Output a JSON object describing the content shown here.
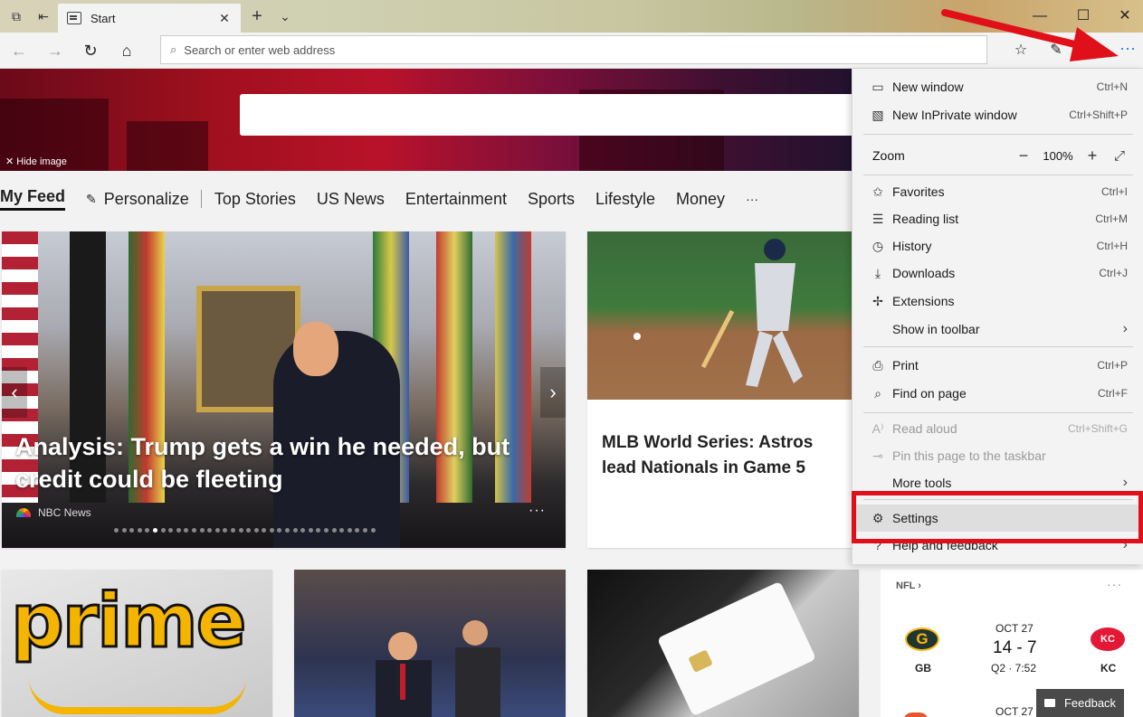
{
  "browser": {
    "tab_title": "Start",
    "address_placeholder": "Search or enter web address"
  },
  "hero": {
    "hide_image_label": "Hide image"
  },
  "feed_nav": {
    "items": [
      "My Feed",
      "Personalize",
      "Top Stories",
      "US News",
      "Entertainment",
      "Sports",
      "Lifestyle",
      "Money",
      "···"
    ]
  },
  "cards": {
    "hero_headline": "Analysis: Trump gets a win he needed, but credit could be fleeting",
    "hero_source": "NBC News",
    "hero_more": "···",
    "carousel_count": 34,
    "carousel_active": 5,
    "mlb_headline": "MLB World Series: Astros lead Nationals in Game 5",
    "prime_text": "prime"
  },
  "nfl": {
    "label": "NFL",
    "more": "···",
    "game1": {
      "date": "OCT 27",
      "score": "14 - 7",
      "clock": "Q2 · 7:52",
      "home": "GB",
      "away": "KC"
    },
    "game2": {
      "date": "OCT 27"
    }
  },
  "feedback_label": "Feedback",
  "menu": {
    "items": [
      {
        "label": "New window",
        "shortcut": "Ctrl+N",
        "icon": "window-icon"
      },
      {
        "label": "New InPrivate window",
        "shortcut": "Ctrl+Shift+P",
        "icon": "inprivate-icon"
      },
      {
        "label": "Favorites",
        "shortcut": "Ctrl+I",
        "icon": "favorites-icon"
      },
      {
        "label": "Reading list",
        "shortcut": "Ctrl+M",
        "icon": "reading-list-icon"
      },
      {
        "label": "History",
        "shortcut": "Ctrl+H",
        "icon": "history-icon"
      },
      {
        "label": "Downloads",
        "shortcut": "Ctrl+J",
        "icon": "download-icon"
      },
      {
        "label": "Extensions",
        "shortcut": "",
        "icon": "extensions-icon"
      },
      {
        "label": "Show in toolbar",
        "shortcut": "",
        "icon": ""
      },
      {
        "label": "Print",
        "shortcut": "Ctrl+P",
        "icon": "print-icon"
      },
      {
        "label": "Find on page",
        "shortcut": "Ctrl+F",
        "icon": "search-icon"
      },
      {
        "label": "Read aloud",
        "shortcut": "Ctrl+Shift+G",
        "icon": "read-aloud-icon"
      },
      {
        "label": "Pin this page to the taskbar",
        "shortcut": "",
        "icon": "pin-icon"
      },
      {
        "label": "More tools",
        "shortcut": "",
        "icon": ""
      },
      {
        "label": "Settings",
        "shortcut": "",
        "icon": "gear-icon"
      },
      {
        "label": "Help and feedback",
        "shortcut": "",
        "icon": "help-icon"
      }
    ],
    "zoom_label": "Zoom",
    "zoom_value": "100%"
  },
  "colors": {
    "accent": "#1a73e8",
    "annotation": "#e0101b"
  }
}
